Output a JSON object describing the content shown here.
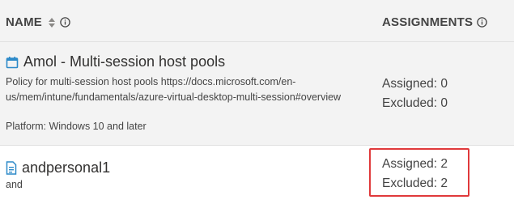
{
  "header": {
    "name_label": "NAME",
    "assignments_label": "ASSIGNMENTS",
    "sort_icon": "sort-updown-icon",
    "info_icon": "info-icon"
  },
  "rows": [
    {
      "icon": "calendar-icon",
      "title": "Amol - Multi-session host pools",
      "description": "Policy for multi-session host pools https://docs.microsoft.com/en-us/mem/intune/fundamentals/azure-virtual-desktop-multi-session#overview",
      "platform": "Platform: Windows 10 and later",
      "assigned": "Assigned: 0",
      "excluded": "Excluded: 0"
    },
    {
      "icon": "document-icon",
      "title": "andpersonal1",
      "description": "and",
      "assigned": "Assigned: 2",
      "excluded": "Excluded: 2"
    }
  ],
  "colors": {
    "header_bg": "#f3f3f3",
    "row_selected_bg": "#f3f3f3",
    "icon_blue": "#2d8ac9",
    "highlight_red": "#e0393b"
  }
}
